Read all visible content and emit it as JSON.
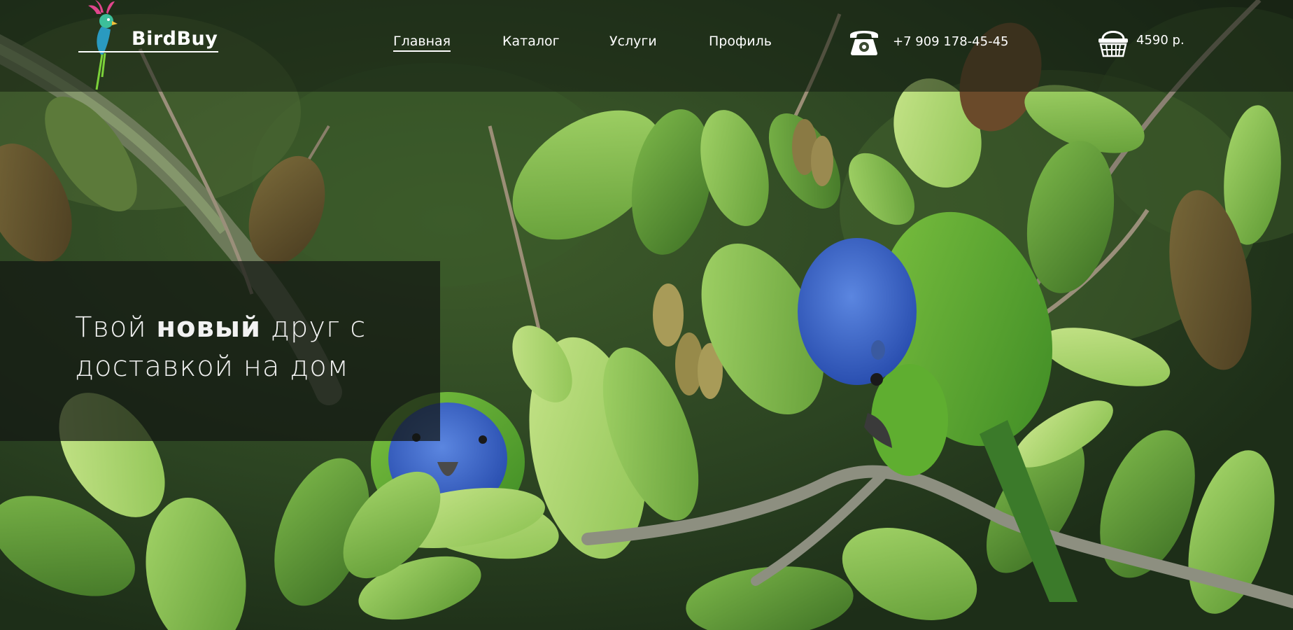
{
  "brand": {
    "name": "BirdBuy"
  },
  "nav": {
    "items": [
      {
        "label": "Главная",
        "active": true
      },
      {
        "label": "Каталог",
        "active": false
      },
      {
        "label": "Услуги",
        "active": false
      },
      {
        "label": "Профиль",
        "active": false
      }
    ]
  },
  "contact": {
    "phone_icon": "phone-icon",
    "phone": "+7 909 178-45-45"
  },
  "cart": {
    "icon": "basket-icon",
    "total": "4590 р."
  },
  "hero": {
    "title_start": "Твой ",
    "title_bold": "новый",
    "title_end": " друг с доставкой на дом"
  },
  "colors": {
    "header_overlay": "#141e12",
    "text": "#ffffff",
    "logo_bird_body": "#3cbf9a",
    "logo_bird_crest": "#e0468c",
    "logo_bird_tail": "#7bd13a"
  }
}
